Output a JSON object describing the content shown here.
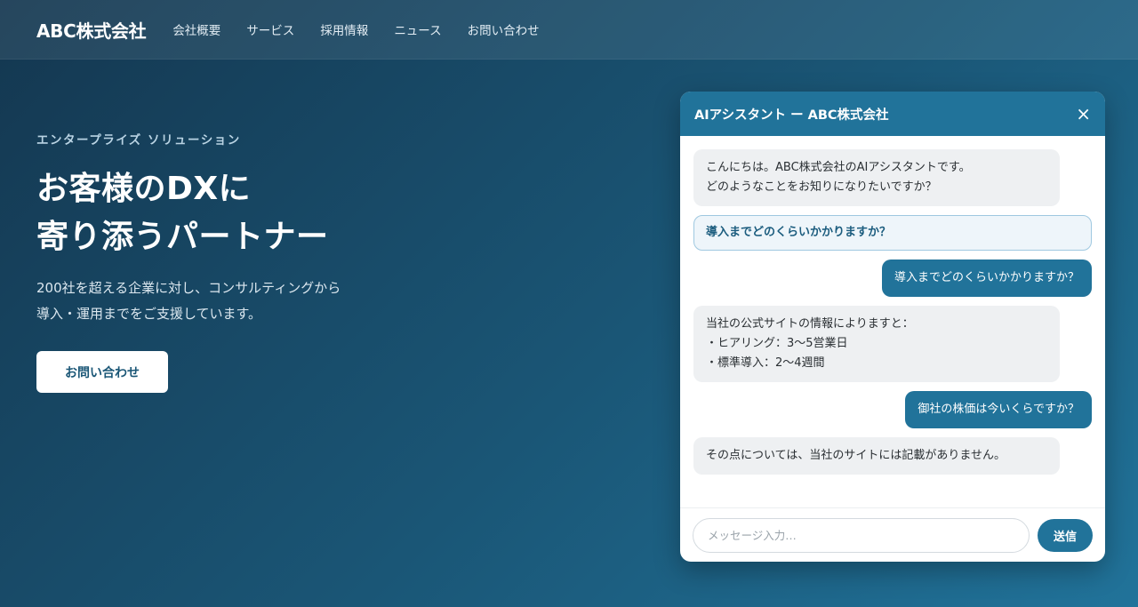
{
  "header": {
    "logo": "ABC株式会社",
    "nav": [
      "会社概要",
      "サービス",
      "採用情報",
      "ニュース",
      "お問い合わせ"
    ]
  },
  "hero": {
    "eyebrow": "エンタープライズ ソリューション",
    "headline_lines": [
      "お客様のDXに",
      "寄り添うパートナー"
    ],
    "lead_lines": [
      "200社を超える企業に対し、コンサルティングから",
      "導入・運用までをご支援しています。"
    ],
    "cta_label": "お問い合わせ"
  },
  "chat": {
    "title": "AIアシスタント ー ABC株式会社",
    "close_icon": "×",
    "messages": [
      {
        "role": "bot",
        "lines": [
          "こんにちは。ABC株式会社のAIアシスタントです。",
          "どのようなことをお知りになりたいですか？"
        ]
      },
      {
        "role": "suggest",
        "lines": [
          "導入までどのくらいかかりますか？"
        ]
      },
      {
        "role": "user",
        "lines": [
          "導入までどのくらいかかりますか？"
        ]
      },
      {
        "role": "bot",
        "lines": [
          "当社の公式サイトの情報によりますと：",
          "・ヒアリング：3〜5営業日",
          "・標準導入：2〜4週間"
        ]
      },
      {
        "role": "user",
        "lines": [
          "御社の株価は今いくらですか？"
        ]
      },
      {
        "role": "bot",
        "lines": [
          "その点については、当社のサイトには記載がありません。"
        ]
      }
    ],
    "input_placeholder": "メッセージ入力…",
    "send_label": "送信"
  },
  "colors": {
    "accent": "#21739a",
    "header_bg": "#2b5f7c",
    "bot_bubble": "#eef0f2"
  }
}
